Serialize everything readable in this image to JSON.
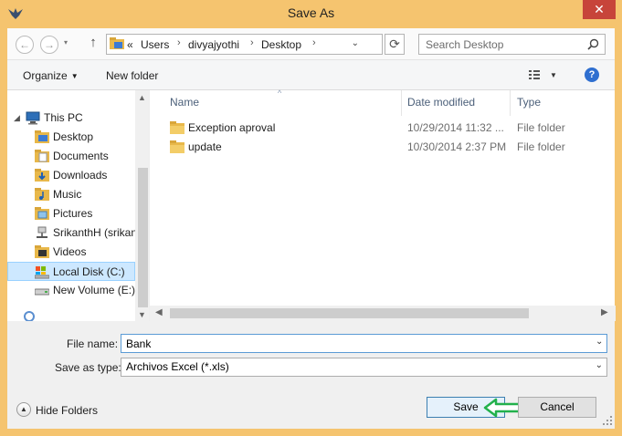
{
  "window": {
    "title": "Save As",
    "close_glyph": "✕"
  },
  "nav": {
    "back_glyph": "←",
    "forward_glyph": "→",
    "up_glyph": "↑",
    "breadcrumbs": [
      "Users",
      "divyajyothi",
      "Desktop"
    ],
    "overflow": "«",
    "refresh_glyph": "⟳"
  },
  "search": {
    "placeholder": "Search Desktop"
  },
  "toolbar": {
    "organize_label": "Organize",
    "new_folder_label": "New folder",
    "help_glyph": "?"
  },
  "tree": {
    "this_pc": "This PC",
    "items": [
      {
        "label": "Desktop",
        "icon": "desktop-folder-icon"
      },
      {
        "label": "Documents",
        "icon": "documents-folder-icon"
      },
      {
        "label": "Downloads",
        "icon": "downloads-folder-icon"
      },
      {
        "label": "Music",
        "icon": "music-folder-icon"
      },
      {
        "label": "Pictures",
        "icon": "pictures-folder-icon"
      },
      {
        "label": "SrikanthH (srikan",
        "icon": "network-user-icon"
      },
      {
        "label": "Videos",
        "icon": "videos-folder-icon"
      },
      {
        "label": "Local Disk (C:)",
        "icon": "local-disk-icon"
      },
      {
        "label": "New Volume (E:)",
        "icon": "drive-icon"
      }
    ],
    "selected": "Local Disk (C:)"
  },
  "files": {
    "columns": [
      "Name",
      "Date modified",
      "Type"
    ],
    "rows": [
      {
        "name": "Exception aproval",
        "date": "10/29/2014 11:32 ...",
        "type": "File folder"
      },
      {
        "name": "update",
        "date": "10/30/2014 2:37 PM",
        "type": "File folder"
      }
    ]
  },
  "form": {
    "filename_label": "File name:",
    "filename_value": "Bank",
    "type_label": "Save as type:",
    "type_value": "Archivos Excel (*.xls)"
  },
  "footer": {
    "hide_folders_label": "Hide Folders",
    "save_label": "Save",
    "cancel_label": "Cancel"
  },
  "colors": {
    "title_bar": "#f5c46f",
    "close_button": "#c7443a",
    "selection": "#cde8ff",
    "folder_yellow": "#e8b84a",
    "annotation_arrow": "#22b14c"
  }
}
